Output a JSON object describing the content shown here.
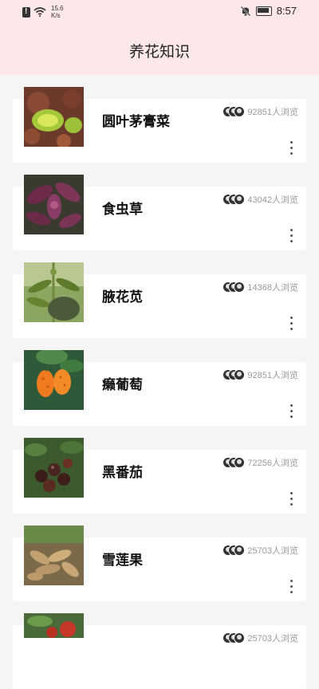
{
  "status_bar": {
    "net_speed_value": "15.6",
    "net_speed_unit": "K/s",
    "time": "8:57"
  },
  "header": {
    "title": "养花知识"
  },
  "items": [
    {
      "name": "圆叶茅膏菜",
      "views": "92851人浏览",
      "image": "plant-photo-sundew"
    },
    {
      "name": "食虫草",
      "views": "43042人浏览",
      "image": "plant-photo-insectivorous"
    },
    {
      "name": "腋花苋",
      "views": "14368人浏览",
      "image": "plant-photo-amaranth"
    },
    {
      "name": "癞葡萄",
      "views": "92851人浏览",
      "image": "plant-photo-bitter-melon"
    },
    {
      "name": "黑番茄",
      "views": "72256人浏览",
      "image": "plant-photo-black-tomato"
    },
    {
      "name": "雪莲果",
      "views": "25703人浏览",
      "image": "plant-photo-yacon"
    },
    {
      "name": "",
      "views": "25703人浏览",
      "image": "plant-photo-red-fruit"
    }
  ]
}
